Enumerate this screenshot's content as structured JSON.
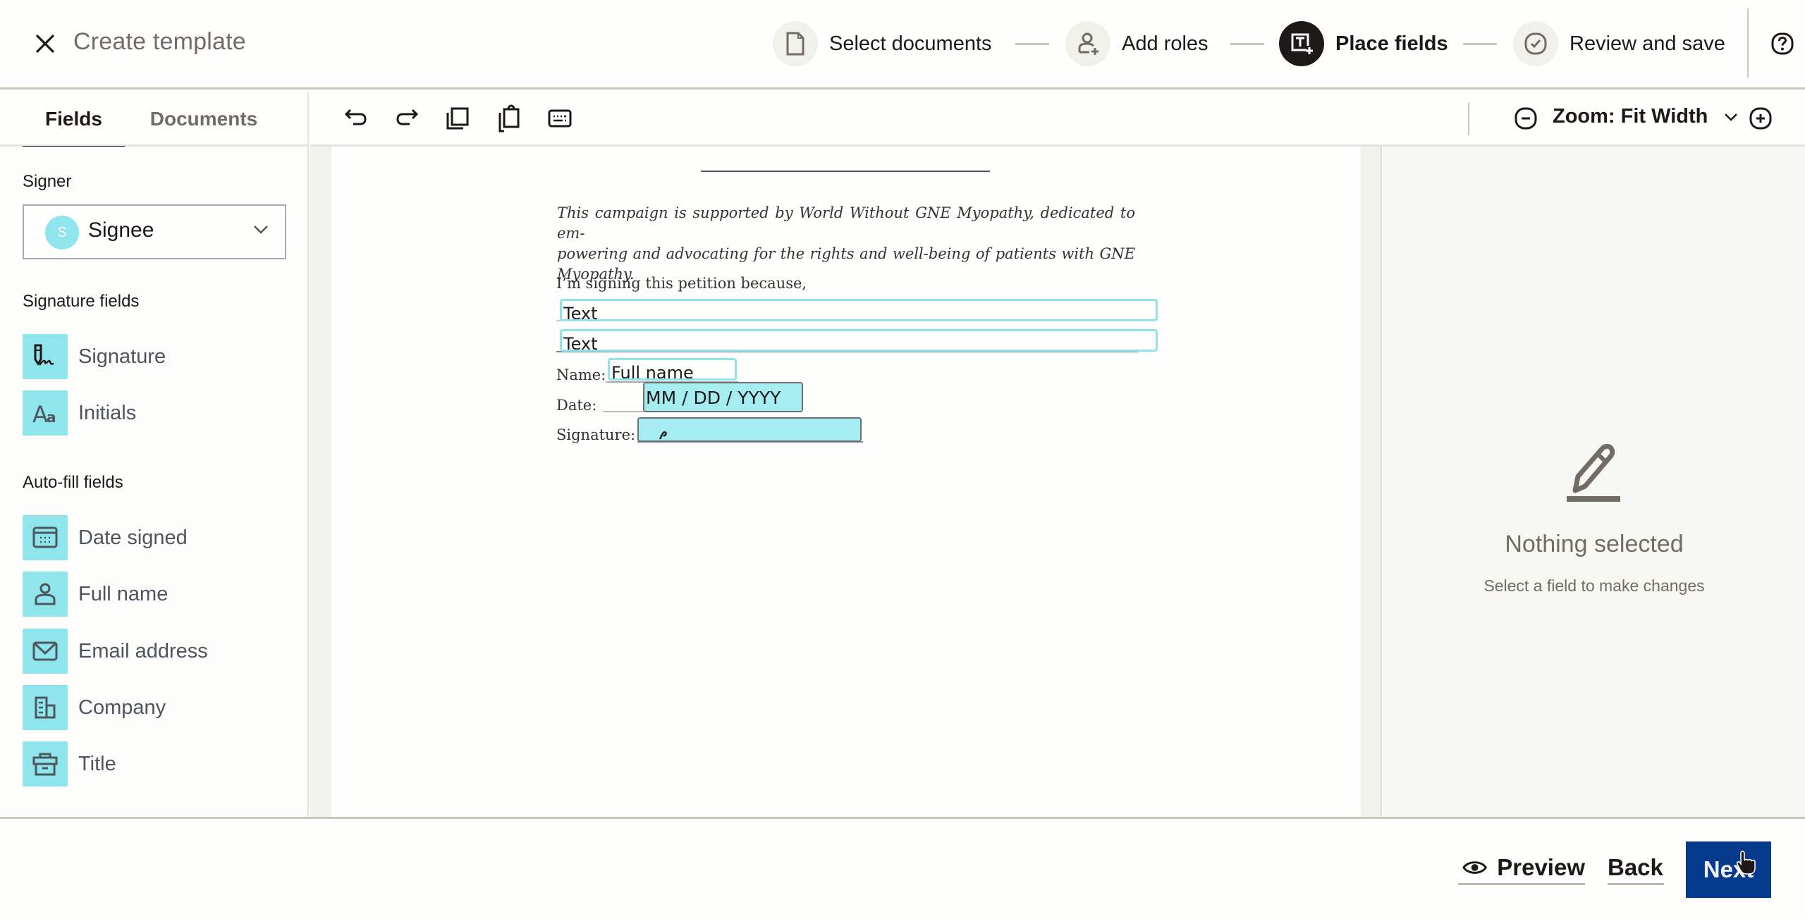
{
  "header": {
    "title": "Create template",
    "close_icon": "close-icon",
    "steps": [
      {
        "label": "Select documents",
        "icon": "document-icon",
        "active": false
      },
      {
        "label": "Add roles",
        "icon": "add-person-icon",
        "active": false
      },
      {
        "label": "Place fields",
        "icon": "text-field-add-icon",
        "active": true
      },
      {
        "label": "Review and save",
        "icon": "check-circle-icon",
        "active": false
      }
    ],
    "help_icon": "help-icon"
  },
  "tabs": [
    {
      "label": "Fields",
      "active": true
    },
    {
      "label": "Documents",
      "active": false
    }
  ],
  "toolbar": {
    "tools": [
      "undo-icon",
      "redo-icon",
      "copy-icon",
      "paste-icon",
      "keyboard-icon"
    ],
    "zoom_label": "Zoom: Fit Width"
  },
  "sidebar": {
    "signer_label": "Signer",
    "signer": {
      "initial": "S",
      "name": "Signee"
    },
    "signature_fields_label": "Signature fields",
    "signature_fields": [
      {
        "label": "Signature",
        "icon": "signature-icon"
      },
      {
        "label": "Initials",
        "icon": "initials-icon"
      }
    ],
    "autofill_fields_label": "Auto-fill fields",
    "autofill_fields": [
      {
        "label": "Date signed",
        "icon": "calendar-icon"
      },
      {
        "label": "Full name",
        "icon": "person-icon"
      },
      {
        "label": "Email address",
        "icon": "envelope-icon"
      },
      {
        "label": "Company",
        "icon": "building-icon"
      },
      {
        "label": "Title",
        "icon": "briefcase-icon"
      }
    ]
  },
  "document": {
    "campaign_text": "This campaign is supported by World Without GNE Myopathy, dedicated to em- powering and advocating for the rights and well-being of patients with GNE Myopathy.",
    "campaign_lines": [
      "This campaign is supported by World Without GNE Myopathy, dedicated to em-",
      "powering and advocating for the rights and well-being of patients with GNE",
      "Myopathy."
    ],
    "reason_label": "I’m signing this petition because,",
    "name_label": "Name:",
    "date_label": "Date:",
    "signature_label": "Signature:",
    "placed_fields": {
      "text1": "Text",
      "text2": "Text",
      "full_name": "Full name",
      "date": "MM / DD / YYYY"
    }
  },
  "right_panel": {
    "title": "Nothing selected",
    "subtitle": "Select a field to make changes"
  },
  "footer": {
    "preview_label": "Preview",
    "back_label": "Back",
    "next_label": "Next"
  },
  "colors": {
    "accent_field": "#8ee5ec",
    "primary_button": "#063a8c",
    "text_dark": "#1e1919",
    "text_muted": "#736c64"
  }
}
